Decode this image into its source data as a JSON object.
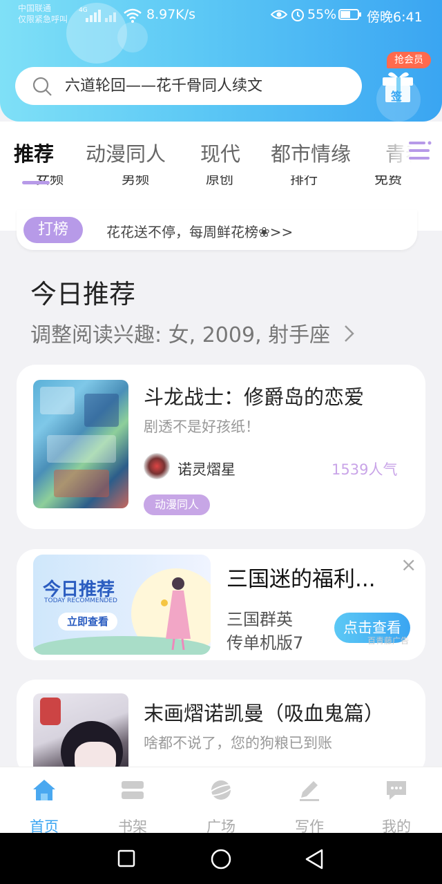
{
  "status_bar": {
    "carrier_line1": "中国联通",
    "carrier_line2": "仅限紧急呼叫",
    "net_tag": "4G",
    "speed": "8.97K/s",
    "battery": "55%",
    "time": "傍晚6:41"
  },
  "search": {
    "placeholder": "六道轮回——花千骨同人续文"
  },
  "checkin": {
    "vip_tag": "抢会员",
    "label": "签"
  },
  "top_tabs": [
    "推荐",
    "动漫同人",
    "现代",
    "都市情缘",
    "青春"
  ],
  "sub_tabs": [
    "女频",
    "男频",
    "原创",
    "排行",
    "免费"
  ],
  "notice": {
    "badge": "打榜",
    "text": "花花送不停，每周鲜花榜❀>>"
  },
  "today": {
    "title": "今日推荐",
    "interest": "调整阅读兴趣: 女, 2009, 射手座",
    "chevron": ">"
  },
  "cards": [
    {
      "title": "斗龙战士：修爵岛的恋爱",
      "subtitle": "剧透不是好孩纸！",
      "author": "诺灵熠星",
      "popularity": "1539人气",
      "tag": "动漫同人"
    },
    {
      "title": "末画熠诺凯曼（吸血鬼篇）",
      "subtitle": "啥都不说了，您的狗粮已到账"
    }
  ],
  "ad": {
    "banner_title": "今日推荐",
    "banner_en": "TODAY RECOMMENDED",
    "banner_btn": "立即查看",
    "title": "三国迷的福利...",
    "desc_line1": "三国群英",
    "desc_line2": "传单机版7",
    "cta": "点击查看",
    "source": "百青藤广告",
    "close": "×"
  },
  "bottom_nav": [
    "首页",
    "书架",
    "广场",
    "写作",
    "我的"
  ],
  "colors": {
    "accent": "#3aa5f2",
    "purple": "#b79ae8",
    "popularity": "#c9a4e8",
    "vip": "#ff6a4d"
  }
}
